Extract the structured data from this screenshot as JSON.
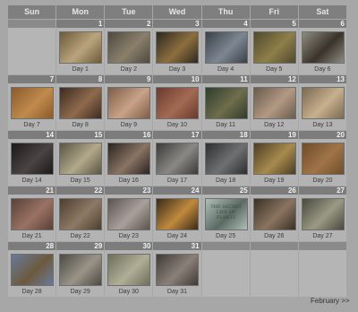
{
  "weekdays": [
    "Sun",
    "Mon",
    "Tue",
    "Wed",
    "Thu",
    "Fri",
    "Sat"
  ],
  "days": [
    {
      "num": "1",
      "label": "Day 1",
      "bg": "#6b5a3a",
      "fg": "#b9a47c"
    },
    {
      "num": "2",
      "label": "Day 2",
      "bg": "#4e4a40",
      "fg": "#8a7f6a"
    },
    {
      "num": "3",
      "label": "Day 3",
      "bg": "#2d2820",
      "fg": "#8d6f3e"
    },
    {
      "num": "4",
      "label": "Day 4",
      "bg": "#3a4048",
      "fg": "#7d8792"
    },
    {
      "num": "5",
      "label": "Day 5",
      "bg": "#4f4a2e",
      "fg": "#8e7f4a"
    },
    {
      "num": "6",
      "label": "Day 6",
      "bg": "#8e8c83",
      "fg": "#3a3329"
    },
    {
      "num": "7",
      "label": "Day 7",
      "bg": "#8a5a2c",
      "fg": "#c08a4c"
    },
    {
      "num": "8",
      "label": "Day 8",
      "bg": "#3b2c22",
      "fg": "#8f6a4c"
    },
    {
      "num": "9",
      "label": "Day 9",
      "bg": "#7d5d48",
      "fg": "#c9a288"
    },
    {
      "num": "10",
      "label": "Day 10",
      "bg": "#6a3a2e",
      "fg": "#a36a52"
    },
    {
      "num": "11",
      "label": "Day 11",
      "bg": "#2f3d2c",
      "fg": "#6f6d4c"
    },
    {
      "num": "12",
      "label": "Day 12",
      "bg": "#6a5a4c",
      "fg": "#b29a84"
    },
    {
      "num": "13",
      "label": "Day 13",
      "bg": "#7a6a52",
      "fg": "#c7b08c"
    },
    {
      "num": "14",
      "label": "Day 14",
      "bg": "#1c1a1a",
      "fg": "#4a4344"
    },
    {
      "num": "15",
      "label": "Day 15",
      "bg": "#5a5644",
      "fg": "#b2a88a"
    },
    {
      "num": "16",
      "label": "Day 16",
      "bg": "#2a2420",
      "fg": "#8a7464"
    },
    {
      "num": "17",
      "label": "Day 17",
      "bg": "#3b3a38",
      "fg": "#8a8884"
    },
    {
      "num": "18",
      "label": "Day 18",
      "bg": "#2c2e30",
      "fg": "#6e7072"
    },
    {
      "num": "19",
      "label": "Day 19",
      "bg": "#4a3e26",
      "fg": "#a88a4e"
    },
    {
      "num": "20",
      "label": "Day 20",
      "bg": "#6e4c2a",
      "fg": "#a07448"
    },
    {
      "num": "21",
      "label": "Day 21",
      "bg": "#5a4036",
      "fg": "#9a7264"
    },
    {
      "num": "22",
      "label": "Day 22",
      "bg": "#4c3e30",
      "fg": "#8e7a64"
    },
    {
      "num": "23",
      "label": "Day 23",
      "bg": "#5c5450",
      "fg": "#aaa09a"
    },
    {
      "num": "24",
      "label": "Day 24",
      "bg": "#3a2a18",
      "fg": "#c08a3e"
    },
    {
      "num": "25",
      "label": "Day 25",
      "bg": "#aebfb8",
      "fg": "#5c6a64",
      "text": "THE SECRET LIFE OF PLANTS"
    },
    {
      "num": "26",
      "label": "Day 26",
      "bg": "#3a3026",
      "fg": "#8a7460"
    },
    {
      "num": "27",
      "label": "Day 27",
      "bg": "#4a4a3e",
      "fg": "#9a9a84"
    },
    {
      "num": "28",
      "label": "Day 28",
      "bg": "#6a7a9a",
      "fg": "#6c5a3e"
    },
    {
      "num": "29",
      "label": "Day 29",
      "bg": "#4c4a44",
      "fg": "#9a9488"
    },
    {
      "num": "30",
      "label": "Day 30",
      "bg": "#6e6e5a",
      "fg": "#b0ae96"
    },
    {
      "num": "31",
      "label": "Day 31",
      "bg": "#3e3a36",
      "fg": "#8a8078"
    }
  ],
  "next_month_link": "February >>"
}
